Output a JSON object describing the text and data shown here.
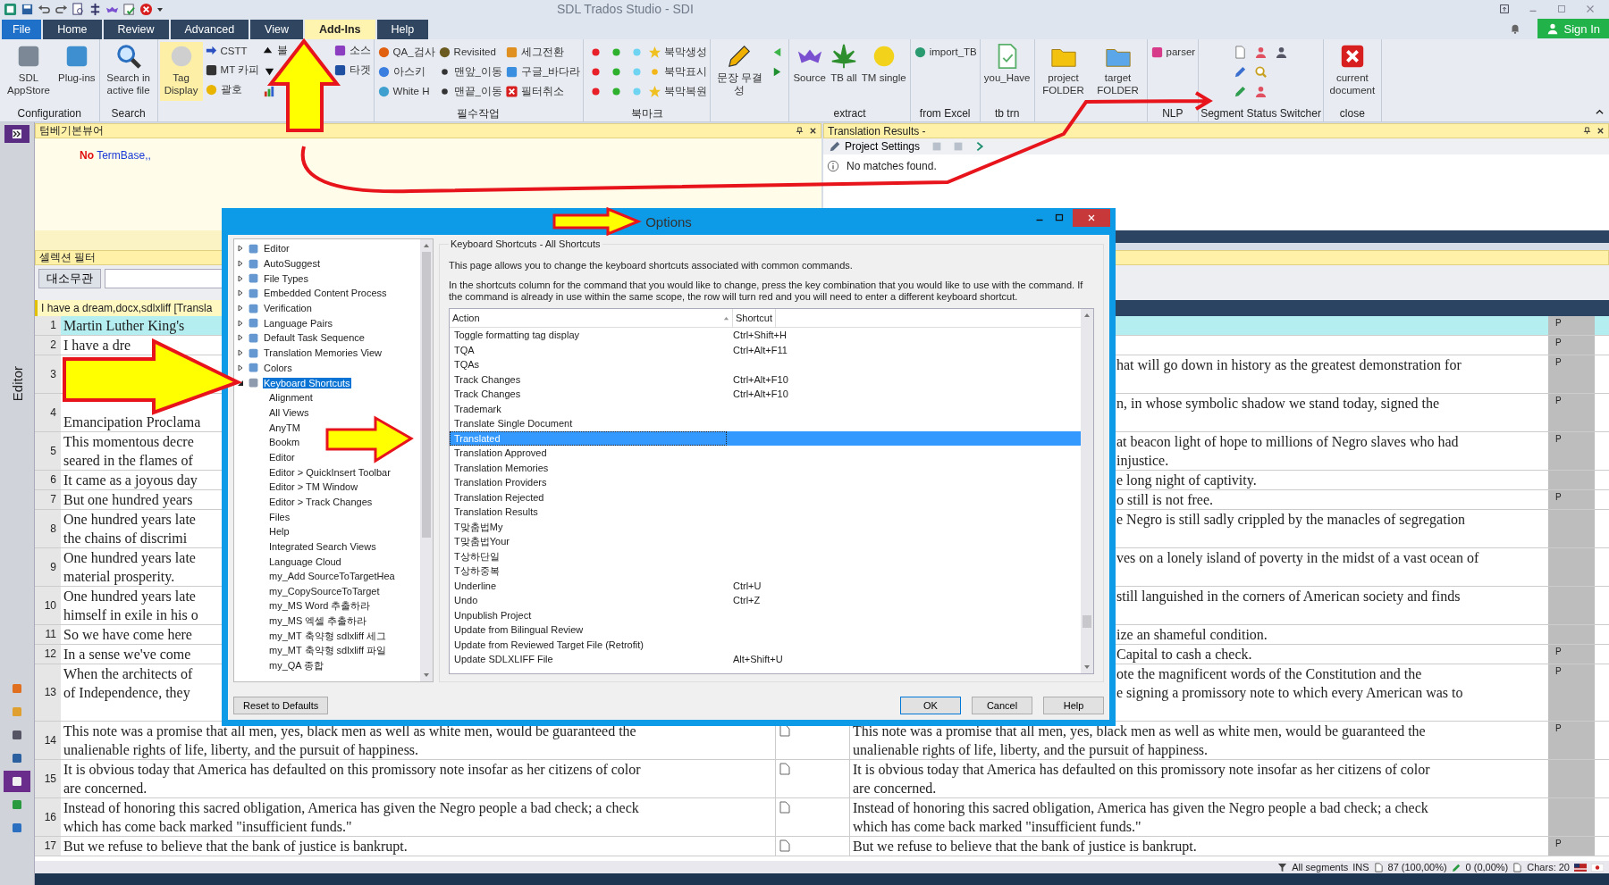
{
  "title_bar": {
    "title": "SDL Trados Studio - SDI",
    "sign_in": "Sign In"
  },
  "tabs": [
    {
      "label": "File",
      "kind": "file",
      "selected": false
    },
    {
      "label": "Home",
      "kind": "tab",
      "selected": false
    },
    {
      "label": "Review",
      "kind": "tab",
      "selected": false
    },
    {
      "label": "Advanced",
      "kind": "tab",
      "selected": false
    },
    {
      "label": "View",
      "kind": "tab",
      "selected": false
    },
    {
      "label": "Add-Ins",
      "kind": "tab",
      "selected": true
    },
    {
      "label": "Help",
      "kind": "tab",
      "selected": false
    }
  ],
  "ribbon": [
    {
      "label": "Configuration",
      "items": [
        {
          "kind": "large",
          "label": "SDL AppStore"
        },
        {
          "kind": "large",
          "label": "Plug-ins"
        }
      ]
    },
    {
      "label": "Search",
      "items": [
        {
          "kind": "large",
          "label": "Search in active file"
        }
      ]
    },
    {
      "items": [
        {
          "kind": "large",
          "label": "Tag Display",
          "on": true
        },
        {
          "kind": "small",
          "label": "CSTT"
        },
        {
          "kind": "small",
          "label": "MT 카피"
        },
        {
          "kind": "small",
          "label": "괄호"
        },
        {
          "kind": "small",
          "label": "불"
        },
        {
          "kind": "icon"
        },
        {
          "kind": "icon"
        },
        {
          "kind": "small",
          "label": "소스"
        },
        {
          "kind": "small",
          "label": "타겟"
        }
      ]
    },
    {
      "label": "필수작업",
      "items": [
        {
          "kind": "small",
          "label": "QA_검사"
        },
        {
          "kind": "small",
          "label": "아스키"
        },
        {
          "kind": "small",
          "label": "White H"
        },
        {
          "kind": "small",
          "label": "Revisited"
        },
        {
          "kind": "small",
          "label": "맨앞_이동"
        },
        {
          "kind": "small",
          "label": "맨끝_이동"
        },
        {
          "kind": "small",
          "label": "세그전환"
        },
        {
          "kind": "small",
          "label": "구글_바다라"
        },
        {
          "kind": "small",
          "label": "필터취소"
        }
      ]
    },
    {
      "label": "북마크",
      "items": [
        {
          "kind": "dot",
          "color": "#e8202a"
        },
        {
          "kind": "dot",
          "color": "#e8202a"
        },
        {
          "kind": "dot",
          "color": "#e8202a"
        },
        {
          "kind": "dot",
          "color": "#2fb12f"
        },
        {
          "kind": "dot",
          "color": "#2fb12f"
        },
        {
          "kind": "dot",
          "color": "#2fb12f"
        },
        {
          "kind": "dot",
          "color": "#6fd3f2"
        },
        {
          "kind": "dot",
          "color": "#6fd3f2"
        },
        {
          "kind": "dot",
          "color": "#6fd3f2"
        },
        {
          "kind": "small",
          "label": "북막생성"
        },
        {
          "kind": "small",
          "label": "북막표시"
        },
        {
          "kind": "small",
          "label": "북막복원"
        }
      ]
    },
    {
      "items": [
        {
          "kind": "large",
          "label": "문장 무결성"
        },
        {
          "kind": "icon"
        },
        {
          "kind": "icon"
        }
      ]
    },
    {
      "label": "extract",
      "items": [
        {
          "kind": "large",
          "label": "Source"
        },
        {
          "kind": "large",
          "label": "TB all"
        },
        {
          "kind": "large",
          "label": "TM single"
        }
      ]
    },
    {
      "label": "from Excel",
      "items": [
        {
          "kind": "small",
          "label": "import_TB"
        }
      ]
    },
    {
      "label": "tb trn",
      "items": [
        {
          "kind": "large",
          "label": "you_Have"
        }
      ]
    },
    {
      "items": [
        {
          "kind": "large",
          "label": "project FOLDER"
        },
        {
          "kind": "large",
          "label": "target FOLDER"
        }
      ]
    },
    {
      "label": "NLP",
      "items": [
        {
          "kind": "small",
          "label": "parser"
        }
      ]
    },
    {
      "label": "Segment Status Switcher",
      "items": [
        {
          "kind": "icon"
        },
        {
          "kind": "icon"
        },
        {
          "kind": "icon"
        },
        {
          "kind": "icon"
        },
        {
          "kind": "icon"
        },
        {
          "kind": "icon"
        },
        {
          "kind": "icon"
        }
      ]
    },
    {
      "label": "close",
      "items": [
        {
          "kind": "large",
          "label": "current document"
        }
      ]
    }
  ],
  "sidebar": {
    "label": "Editor",
    "nav": [
      {
        "selected": false
      },
      {
        "selected": false
      },
      {
        "selected": false
      },
      {
        "selected": false
      },
      {
        "selected": true
      },
      {
        "selected": false
      },
      {
        "selected": false
      }
    ]
  },
  "termbase_panel": {
    "title": "텀베기본뷰어",
    "no": "No",
    "message": "TermBase,,"
  },
  "results_panel": {
    "title": "Translation Results -",
    "tool": "Project Settings",
    "message": "No matches found."
  },
  "filter_panel": {
    "title": "셀렉션 필터",
    "button": "대소무관"
  },
  "file_header": "I have a dream,docx,sdlxliff [Transla",
  "segments": [
    {
      "number": "1",
      "source": [
        "Martin Luther King's"
      ],
      "flag": "P",
      "kind": "new",
      "selected": true
    },
    {
      "number": "2",
      "source": [
        "I have a dre"
      ],
      "flag": "P",
      "kind": "new",
      "selected": false
    },
    {
      "number": "3",
      "target": [
        "hat will go down in history as the greatest demonstration for"
      ],
      "flag": "P",
      "kind": "new",
      "selected": false
    },
    {
      "number": "4",
      "source": [
        "Emancipation Proclama"
      ],
      "target": [
        "n, in whose symbolic shadow we stand today, signed the"
      ],
      "flag": "P",
      "kind": "new",
      "selected": false
    },
    {
      "number": "5",
      "source": [
        "This momentous decre",
        "seared in the flames of"
      ],
      "target": [
        "at beacon light of hope to millions of Negro slaves who had",
        "injustice."
      ],
      "flag": "P",
      "kind": "new",
      "selected": false
    },
    {
      "number": "6",
      "source": [
        "It came as a joyous day"
      ],
      "target": [
        "e long night of captivity."
      ],
      "kind": "new",
      "selected": false
    },
    {
      "number": "7",
      "source": [
        "But one hundred years"
      ],
      "target": [
        "o still is not free."
      ],
      "flag": "P",
      "kind": "new",
      "selected": false
    },
    {
      "number": "8",
      "source": [
        "One hundred years late",
        "the chains of discrimi"
      ],
      "target": [
        "e Negro is still sadly crippled by the manacles of segregation"
      ],
      "kind": "new",
      "selected": false
    },
    {
      "number": "9",
      "source": [
        "One hundred years late",
        "material prosperity."
      ],
      "target": [
        "ves on a lonely island of poverty in the midst of a vast ocean of"
      ],
      "kind": "new",
      "selected": false
    },
    {
      "number": "10",
      "source": [
        "One hundred years late",
        "himself in exile in his o"
      ],
      "target": [
        "still languished in the corners of American society and finds"
      ],
      "kind": "new",
      "selected": false
    },
    {
      "number": "11",
      "source": [
        "So we have come here"
      ],
      "target": [
        "ize an shameful condition."
      ],
      "kind": "new",
      "selected": false
    },
    {
      "number": "12",
      "source": [
        "In a sense we've come"
      ],
      "target": [
        "Capital to cash a check."
      ],
      "flag": "P",
      "kind": "new",
      "selected": false
    },
    {
      "number": "13",
      "source": [
        "When the architects of",
        "of Independence, they"
      ],
      "target": [
        "ote the magnificent words of the Constitution and the",
        "e signing a promissory note to which every American was to"
      ],
      "flag": "P",
      "kind": "new",
      "selected": false
    },
    {
      "number": "14",
      "source": [
        "This note was a promise that all men, yes, black men as well as white men, would be guaranteed the",
        "unalienable rights of life, liberty, and the pursuit of happiness."
      ],
      "target": [
        "This note was a promise that all men, yes, black men as well as white men, would be guaranteed the",
        "unalienable rights of life, liberty, and the pursuit of happiness."
      ],
      "kind": "draft",
      "flag": "P",
      "selected": false
    },
    {
      "number": "15",
      "source": [
        "It is obvious today that America has defaulted on this promissory note insofar as her citizens of color",
        "are concerned."
      ],
      "target": [
        "It is obvious today that America has defaulted on this promissory note insofar as her citizens of color",
        "are concerned."
      ],
      "kind": "draft",
      "selected": false
    },
    {
      "number": "16",
      "source": [
        "Instead of honoring this sacred obligation, America has given the Negro people a bad check; a check",
        "which has come back marked \"insufficient funds.\""
      ],
      "target": [
        "Instead of honoring this sacred obligation, America has given the Negro people a bad check; a check",
        "which has come back marked \"insufficient funds.\""
      ],
      "kind": "draft",
      "selected": false
    },
    {
      "number": "17",
      "source": [
        "But we refuse to believe that the bank of justice is bankrupt."
      ],
      "target": [
        "But we refuse to believe that the bank of justice is bankrupt."
      ],
      "kind": "draft",
      "flag": "P",
      "selected": false
    }
  ],
  "status_bar": {
    "filter": "All segments",
    "mode": "INS",
    "words": "87 (100,00%)",
    "confirmed": "0 (0,00%)",
    "chars": "Chars: 20"
  },
  "dialog": {
    "title": "Options",
    "tree": [
      {
        "label": "Editor",
        "expanded": false,
        "selected": false
      },
      {
        "label": "AutoSuggest",
        "expanded": false,
        "selected": false
      },
      {
        "label": "File Types",
        "expanded": false,
        "selected": false
      },
      {
        "label": "Embedded Content Process",
        "expanded": false,
        "selected": false
      },
      {
        "label": "Verification",
        "expanded": false,
        "selected": false
      },
      {
        "label": "Language Pairs",
        "expanded": false,
        "selected": false
      },
      {
        "label": "Default Task Sequence",
        "expanded": false,
        "selected": false
      },
      {
        "label": "Translation Memories View",
        "expanded": false,
        "selected": false
      },
      {
        "label": "Colors",
        "expanded": false,
        "selected": false
      },
      {
        "label": "Keyboard Shortcuts",
        "expanded": true,
        "selected": true,
        "children": [
          {
            "label": "Alignment",
            "selected": false
          },
          {
            "label": "All Views",
            "selected": false
          },
          {
            "label": "AnyTM",
            "selected": false
          },
          {
            "label": "Bookm",
            "selected": false
          },
          {
            "label": "Editor",
            "selected": false
          },
          {
            "label": "Editor >  QuickInsert Toolbar",
            "selected": false
          },
          {
            "label": "Editor > TM Window",
            "selected": false
          },
          {
            "label": "Editor > Track Changes",
            "selected": false
          },
          {
            "label": "Files",
            "selected": false
          },
          {
            "label": "Help",
            "selected": false
          },
          {
            "label": "Integrated Search Views",
            "selected": false
          },
          {
            "label": "Language Cloud",
            "selected": false
          },
          {
            "label": "my_Add SourceToTargetHea",
            "selected": false
          },
          {
            "label": "my_CopySourceToTarget",
            "selected": false
          },
          {
            "label": "my_MS Word 추출하라",
            "selected": false
          },
          {
            "label": "my_MS 엑셀 추출하라",
            "selected": false
          },
          {
            "label": "my_MT 축약형 sdlxliff 세그",
            "selected": false
          },
          {
            "label": "my_MT 축약형 sdlxliff 파일",
            "selected": false
          },
          {
            "label": "my_QA 종합",
            "selected": false
          }
        ]
      }
    ],
    "heading": "Keyboard Shortcuts - All Shortcuts",
    "intro": "This page allows you to change the keyboard shortcuts associated with common commands.",
    "instructions": "In the shortcuts column for the command that you would like to change, press the key combination that you would like to use with the command.  If the command is already in use within the same scope, the row will turn red and you will need to enter a different keyboard shortcut.",
    "columns": [
      "Action",
      "Shortcut"
    ],
    "rows": [
      {
        "action": "Toggle formatting tag display",
        "shortcut": "Ctrl+Shift+H",
        "selected": false
      },
      {
        "action": "TQA",
        "shortcut": "Ctrl+Alt+F11",
        "selected": false
      },
      {
        "action": "TQAs",
        "selected": false
      },
      {
        "action": "Track Changes",
        "shortcut": "Ctrl+Alt+F10",
        "selected": false
      },
      {
        "action": "Track Changes",
        "shortcut": "Ctrl+Alt+F10",
        "selected": false
      },
      {
        "action": "Trademark",
        "selected": false
      },
      {
        "action": "Translate Single Document",
        "selected": false
      },
      {
        "action": "Translated",
        "selected": true
      },
      {
        "action": "Translation Approved",
        "selected": false
      },
      {
        "action": "Translation Memories",
        "selected": false
      },
      {
        "action": "Translation Providers",
        "selected": false
      },
      {
        "action": "Translation Rejected",
        "selected": false
      },
      {
        "action": "Translation Results",
        "selected": false
      },
      {
        "action": "T맞춤법My",
        "selected": false
      },
      {
        "action": "T맞춤법Your",
        "selected": false
      },
      {
        "action": "T상하단일",
        "selected": false
      },
      {
        "action": "T상하중복",
        "selected": false
      },
      {
        "action": "Underline",
        "shortcut": "Ctrl+U",
        "selected": false
      },
      {
        "action": "Undo",
        "shortcut": "Ctrl+Z",
        "selected": false
      },
      {
        "action": "Unpublish Project",
        "selected": false
      },
      {
        "action": "Update from Bilingual Review",
        "selected": false
      },
      {
        "action": "Update from Reviewed Target File (Retrofit)",
        "selected": false
      },
      {
        "action": "Update SDLXLIFF File",
        "shortcut": "Alt+Shift+U",
        "selected": false
      }
    ],
    "buttons": {
      "reset": "Reset to Defaults",
      "ok": "OK",
      "cancel": "Cancel",
      "help": "Help"
    }
  }
}
